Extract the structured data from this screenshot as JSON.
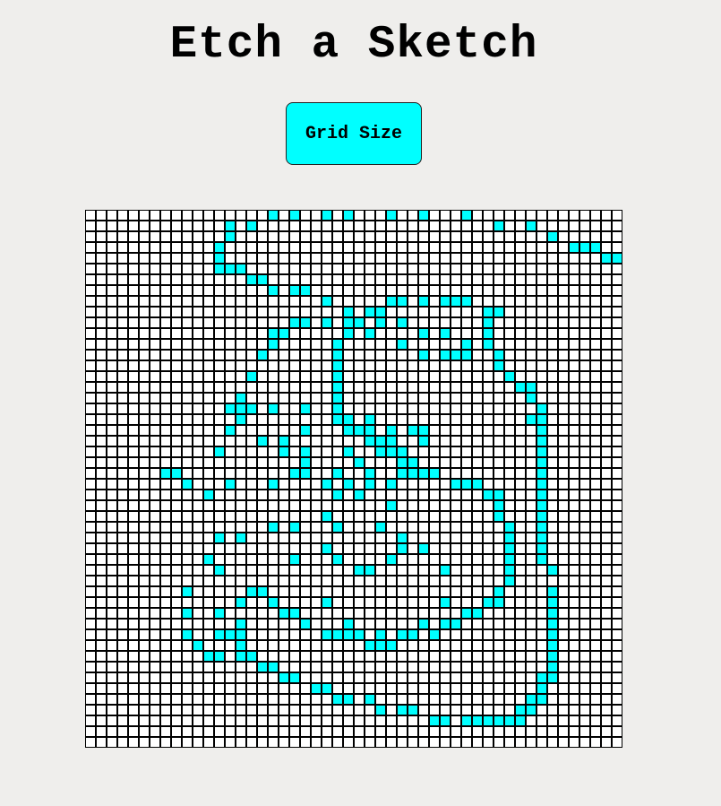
{
  "app": {
    "title": "Etch a Sketch"
  },
  "controls": {
    "grid_size_label": "Grid Size"
  },
  "colors": {
    "background": "#efeeec",
    "cell_empty": "#ffffff",
    "cell_painted": "#00ffff",
    "grid_line": "#000000",
    "button_background": "#00ffff"
  },
  "grid": {
    "size": 50,
    "painted_cells": [
      [
        0,
        17
      ],
      [
        0,
        19
      ],
      [
        0,
        22
      ],
      [
        0,
        24
      ],
      [
        0,
        28
      ],
      [
        0,
        31
      ],
      [
        0,
        35
      ],
      [
        1,
        13
      ],
      [
        1,
        15
      ],
      [
        1,
        38
      ],
      [
        1,
        41
      ],
      [
        2,
        13
      ],
      [
        2,
        43
      ],
      [
        3,
        12
      ],
      [
        3,
        45
      ],
      [
        3,
        46
      ],
      [
        3,
        47
      ],
      [
        4,
        12
      ],
      [
        4,
        48
      ],
      [
        4,
        49
      ],
      [
        5,
        12
      ],
      [
        5,
        13
      ],
      [
        5,
        14
      ],
      [
        6,
        15
      ],
      [
        6,
        16
      ],
      [
        7,
        17
      ],
      [
        7,
        19
      ],
      [
        7,
        20
      ],
      [
        8,
        22
      ],
      [
        8,
        28
      ],
      [
        8,
        29
      ],
      [
        8,
        31
      ],
      [
        8,
        33
      ],
      [
        8,
        34
      ],
      [
        8,
        35
      ],
      [
        9,
        24
      ],
      [
        9,
        26
      ],
      [
        9,
        27
      ],
      [
        9,
        37
      ],
      [
        9,
        38
      ],
      [
        10,
        19
      ],
      [
        10,
        20
      ],
      [
        10,
        22
      ],
      [
        10,
        24
      ],
      [
        10,
        25
      ],
      [
        10,
        27
      ],
      [
        10,
        29
      ],
      [
        10,
        37
      ],
      [
        11,
        17
      ],
      [
        11,
        18
      ],
      [
        11,
        24
      ],
      [
        11,
        26
      ],
      [
        11,
        31
      ],
      [
        11,
        33
      ],
      [
        11,
        37
      ],
      [
        12,
        17
      ],
      [
        12,
        23
      ],
      [
        12,
        29
      ],
      [
        12,
        35
      ],
      [
        12,
        37
      ],
      [
        13,
        16
      ],
      [
        13,
        23
      ],
      [
        13,
        31
      ],
      [
        13,
        33
      ],
      [
        13,
        34
      ],
      [
        13,
        35
      ],
      [
        13,
        38
      ],
      [
        14,
        23
      ],
      [
        14,
        38
      ],
      [
        15,
        15
      ],
      [
        15,
        23
      ],
      [
        15,
        39
      ],
      [
        16,
        23
      ],
      [
        16,
        40
      ],
      [
        16,
        41
      ],
      [
        17,
        14
      ],
      [
        17,
        23
      ],
      [
        17,
        41
      ],
      [
        18,
        13
      ],
      [
        18,
        14
      ],
      [
        18,
        15
      ],
      [
        18,
        17
      ],
      [
        18,
        20
      ],
      [
        18,
        23
      ],
      [
        18,
        42
      ],
      [
        19,
        14
      ],
      [
        19,
        23
      ],
      [
        19,
        24
      ],
      [
        19,
        26
      ],
      [
        19,
        41
      ],
      [
        19,
        42
      ],
      [
        20,
        13
      ],
      [
        20,
        20
      ],
      [
        20,
        24
      ],
      [
        20,
        25
      ],
      [
        20,
        26
      ],
      [
        20,
        28
      ],
      [
        20,
        30
      ],
      [
        20,
        31
      ],
      [
        20,
        42
      ],
      [
        21,
        16
      ],
      [
        21,
        18
      ],
      [
        21,
        26
      ],
      [
        21,
        27
      ],
      [
        21,
        28
      ],
      [
        21,
        31
      ],
      [
        21,
        42
      ],
      [
        22,
        12
      ],
      [
        22,
        18
      ],
      [
        22,
        20
      ],
      [
        22,
        24
      ],
      [
        22,
        27
      ],
      [
        22,
        28
      ],
      [
        22,
        29
      ],
      [
        22,
        42
      ],
      [
        23,
        20
      ],
      [
        23,
        25
      ],
      [
        23,
        29
      ],
      [
        23,
        30
      ],
      [
        23,
        42
      ],
      [
        24,
        7
      ],
      [
        24,
        8
      ],
      [
        24,
        19
      ],
      [
        24,
        20
      ],
      [
        24,
        23
      ],
      [
        24,
        26
      ],
      [
        24,
        29
      ],
      [
        24,
        30
      ],
      [
        24,
        31
      ],
      [
        24,
        32
      ],
      [
        24,
        42
      ],
      [
        25,
        9
      ],
      [
        25,
        13
      ],
      [
        25,
        17
      ],
      [
        25,
        22
      ],
      [
        25,
        24
      ],
      [
        25,
        26
      ],
      [
        25,
        28
      ],
      [
        25,
        34
      ],
      [
        25,
        35
      ],
      [
        25,
        36
      ],
      [
        25,
        42
      ],
      [
        26,
        11
      ],
      [
        26,
        23
      ],
      [
        26,
        25
      ],
      [
        26,
        37
      ],
      [
        26,
        38
      ],
      [
        26,
        42
      ],
      [
        27,
        28
      ],
      [
        27,
        38
      ],
      [
        27,
        42
      ],
      [
        28,
        22
      ],
      [
        28,
        38
      ],
      [
        28,
        42
      ],
      [
        29,
        17
      ],
      [
        29,
        19
      ],
      [
        29,
        23
      ],
      [
        29,
        27
      ],
      [
        29,
        39
      ],
      [
        29,
        42
      ],
      [
        30,
        12
      ],
      [
        30,
        14
      ],
      [
        30,
        29
      ],
      [
        30,
        39
      ],
      [
        30,
        42
      ],
      [
        31,
        22
      ],
      [
        31,
        29
      ],
      [
        31,
        31
      ],
      [
        31,
        39
      ],
      [
        31,
        42
      ],
      [
        32,
        11
      ],
      [
        32,
        19
      ],
      [
        32,
        23
      ],
      [
        32,
        28
      ],
      [
        32,
        39
      ],
      [
        32,
        42
      ],
      [
        33,
        12
      ],
      [
        33,
        25
      ],
      [
        33,
        26
      ],
      [
        33,
        33
      ],
      [
        33,
        39
      ],
      [
        33,
        43
      ],
      [
        34,
        39
      ],
      [
        35,
        9
      ],
      [
        35,
        15
      ],
      [
        35,
        16
      ],
      [
        35,
        38
      ],
      [
        35,
        43
      ],
      [
        36,
        14
      ],
      [
        36,
        17
      ],
      [
        36,
        22
      ],
      [
        36,
        33
      ],
      [
        36,
        37
      ],
      [
        36,
        38
      ],
      [
        36,
        43
      ],
      [
        37,
        9
      ],
      [
        37,
        12
      ],
      [
        37,
        18
      ],
      [
        37,
        19
      ],
      [
        37,
        35
      ],
      [
        37,
        36
      ],
      [
        37,
        43
      ],
      [
        38,
        14
      ],
      [
        38,
        20
      ],
      [
        38,
        24
      ],
      [
        38,
        31
      ],
      [
        38,
        33
      ],
      [
        38,
        34
      ],
      [
        38,
        43
      ],
      [
        39,
        9
      ],
      [
        39,
        12
      ],
      [
        39,
        13
      ],
      [
        39,
        14
      ],
      [
        39,
        22
      ],
      [
        39,
        23
      ],
      [
        39,
        24
      ],
      [
        39,
        25
      ],
      [
        39,
        27
      ],
      [
        39,
        29
      ],
      [
        39,
        30
      ],
      [
        39,
        32
      ],
      [
        39,
        43
      ],
      [
        40,
        10
      ],
      [
        40,
        14
      ],
      [
        40,
        26
      ],
      [
        40,
        27
      ],
      [
        40,
        28
      ],
      [
        40,
        43
      ],
      [
        41,
        11
      ],
      [
        41,
        12
      ],
      [
        41,
        14
      ],
      [
        41,
        15
      ],
      [
        41,
        43
      ],
      [
        42,
        16
      ],
      [
        42,
        17
      ],
      [
        42,
        43
      ],
      [
        43,
        18
      ],
      [
        43,
        19
      ],
      [
        43,
        42
      ],
      [
        43,
        43
      ],
      [
        44,
        21
      ],
      [
        44,
        22
      ],
      [
        44,
        42
      ],
      [
        45,
        23
      ],
      [
        45,
        24
      ],
      [
        45,
        26
      ],
      [
        45,
        41
      ],
      [
        45,
        42
      ],
      [
        46,
        27
      ],
      [
        46,
        29
      ],
      [
        46,
        30
      ],
      [
        46,
        40
      ],
      [
        46,
        41
      ],
      [
        47,
        32
      ],
      [
        47,
        33
      ],
      [
        47,
        35
      ],
      [
        47,
        36
      ],
      [
        47,
        37
      ],
      [
        47,
        38
      ],
      [
        47,
        39
      ],
      [
        47,
        40
      ]
    ]
  }
}
